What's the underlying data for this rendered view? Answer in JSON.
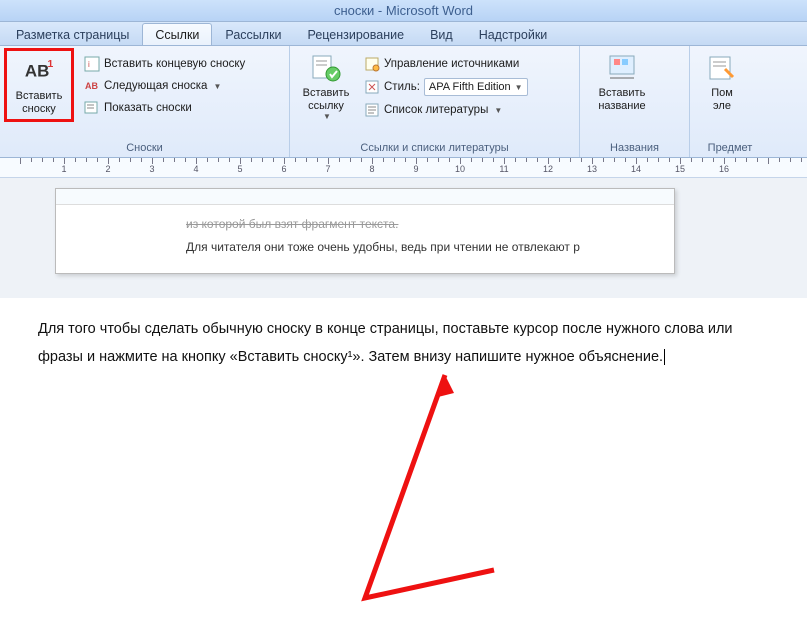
{
  "window": {
    "title": "сноски - Microsoft Word"
  },
  "tabs": {
    "items": [
      {
        "label": "Разметка страницы"
      },
      {
        "label": "Ссылки"
      },
      {
        "label": "Рассылки"
      },
      {
        "label": "Рецензирование"
      },
      {
        "label": "Вид"
      },
      {
        "label": "Надстройки"
      }
    ],
    "activeIndex": 1
  },
  "ribbon": {
    "footnotes": {
      "insert": "Вставить\nсноску",
      "insertEndnote": "Вставить концевую сноску",
      "next": "Следующая сноска",
      "show": "Показать сноски",
      "group": "Сноски"
    },
    "citations": {
      "insertCite": "Вставить\nссылку",
      "manage": "Управление источниками",
      "styleLabel": "Стиль:",
      "styleValue": "APA Fifth Edition",
      "bibliography": "Список литературы",
      "group": "Ссылки и списки литературы"
    },
    "captions": {
      "insert": "Вставить\nназвание",
      "group": "Названия"
    },
    "index": {
      "mark": "Пом\nэле",
      "group": "Предмет"
    }
  },
  "ruler": {
    "labels": [
      "1",
      "2",
      "3",
      "4",
      "5",
      "6",
      "7",
      "8",
      "9",
      "10",
      "11",
      "12",
      "13",
      "14",
      "15",
      "16"
    ]
  },
  "document": {
    "line1": "из которой был взят фрагмент текста.",
    "line2": "Для читателя они тоже очень удобны, ведь при чтении не отвлекают р"
  },
  "annotation": {
    "text": "Для того чтобы сделать обычную сноску в конце страницы, поставьте курсор после нужного слова или фразы и нажмите на кнопку «Вставить сноску¹». Затем внизу напишите нужное объяснение."
  }
}
